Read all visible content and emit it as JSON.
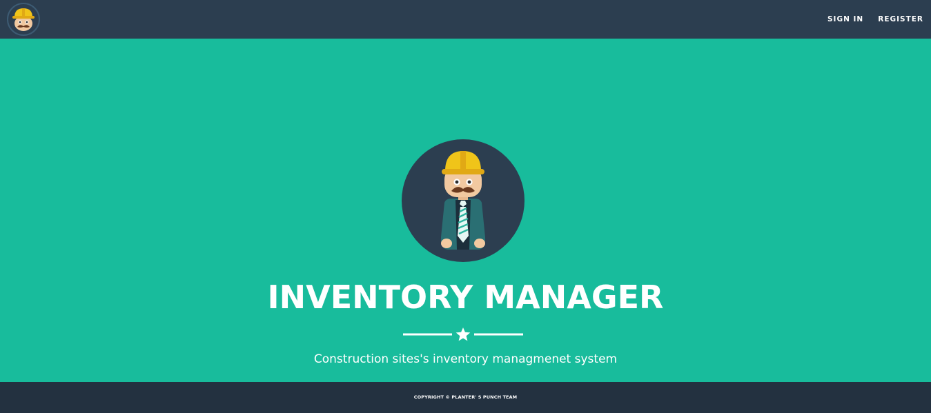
{
  "nav": {
    "sign_in": "SIGN IN",
    "register": "REGISTER"
  },
  "hero": {
    "title": "INVENTORY MANAGER",
    "subtitle": "Construction sites's inventory managmenet system"
  },
  "footer": {
    "copyright": "COPYRIGHT © PLANTER' S PUNCH TEAM"
  },
  "colors": {
    "navbar": "#2c3e50",
    "hero_background": "#18bc9c",
    "footer": "#233140",
    "text": "#ffffff",
    "helmet": "#f0c419"
  },
  "icons": {
    "brand": "worker-helmet-logo-icon",
    "hero": "construction-worker-avatar-icon",
    "divider": "star-icon"
  }
}
